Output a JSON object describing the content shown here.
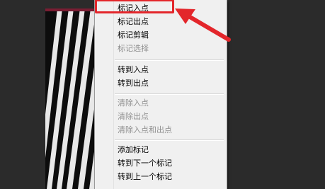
{
  "menu": {
    "group1": [
      {
        "label": "标记入点",
        "enabled": true
      },
      {
        "label": "标记出点",
        "enabled": true
      },
      {
        "label": "标记剪辑",
        "enabled": true
      },
      {
        "label": "标记选择",
        "enabled": false
      }
    ],
    "group2": [
      {
        "label": "转到入点",
        "enabled": true
      },
      {
        "label": "转到出点",
        "enabled": true
      }
    ],
    "group3": [
      {
        "label": "清除入点",
        "enabled": false
      },
      {
        "label": "清除出点",
        "enabled": false
      },
      {
        "label": "清除入点和出点",
        "enabled": false
      }
    ],
    "group4": [
      {
        "label": "添加标记",
        "enabled": true
      },
      {
        "label": "转到下一个标记",
        "enabled": true
      },
      {
        "label": "转到上一个标记",
        "enabled": true
      }
    ]
  },
  "annotation": {
    "color": "#e3262b",
    "target": "标记入点"
  },
  "colors": {
    "menu_bg": "#f0f0f0",
    "disabled_text": "#8f8f8f",
    "background": "#2b2b2b",
    "preview": "#0d0d0d"
  }
}
